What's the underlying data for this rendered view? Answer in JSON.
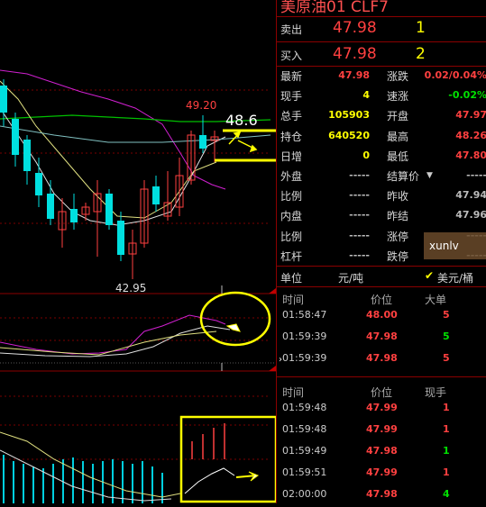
{
  "title": "美原油01  CLF7",
  "sell": {
    "label": "卖出",
    "price": "47.98",
    "qty": "1"
  },
  "buy": {
    "label": "买入",
    "price": "47.98",
    "qty": "2"
  },
  "stats_left": [
    {
      "label": "最新",
      "value": "47.98",
      "color": "red"
    },
    {
      "label": "现手",
      "value": "4",
      "color": "yellow"
    },
    {
      "label": "总手",
      "value": "105903",
      "color": "yellow"
    },
    {
      "label": "持仓",
      "value": "640520",
      "color": "yellow"
    },
    {
      "label": "日增",
      "value": "0",
      "color": "yellow"
    },
    {
      "label": "外盘",
      "value": "-----",
      "color": "gray"
    },
    {
      "label": "比例",
      "value": "-----",
      "color": "gray"
    },
    {
      "label": "内盘",
      "value": "-----",
      "color": "gray"
    },
    {
      "label": "比例",
      "value": "-----",
      "color": "gray"
    },
    {
      "label": "杠杆",
      "value": "-----",
      "color": "gray"
    }
  ],
  "stats_right": [
    {
      "label": "涨跌",
      "value": "0.02/0.04%",
      "color": "red"
    },
    {
      "label": "速涨",
      "value": "-0.02%",
      "color": "green"
    },
    {
      "label": "开盘",
      "value": "47.97",
      "color": "red"
    },
    {
      "label": "最高",
      "value": "48.26",
      "color": "red"
    },
    {
      "label": "最低",
      "value": "47.80",
      "color": "red"
    },
    {
      "label": "结算价",
      "value": "-----",
      "color": "gray"
    },
    {
      "label": "昨收",
      "value": "47.94",
      "color": "gray"
    },
    {
      "label": "昨结",
      "value": "47.96",
      "color": "gray"
    },
    {
      "label": "涨停",
      "value": "-----",
      "color": "gray"
    },
    {
      "label": "跌停",
      "value": "-----",
      "color": "gray"
    }
  ],
  "watermark": "xunlv",
  "unit_row": {
    "label": "单位",
    "unit": "元/吨",
    "currency": "美元/桶"
  },
  "trades1": {
    "headers": [
      "时间",
      "价位",
      "大单"
    ],
    "rows": [
      {
        "time": "01:58:47",
        "price": "48.00",
        "qty": "5",
        "qcolor": "red"
      },
      {
        "time": "01:59:39",
        "price": "47.98",
        "qty": "5",
        "qcolor": "green"
      },
      {
        "time": "01:59:39",
        "price": "47.98",
        "qty": "5",
        "qcolor": "red"
      }
    ]
  },
  "trades2": {
    "headers": [
      "时间",
      "价位",
      "现手"
    ],
    "rows": [
      {
        "time": "01:59:48",
        "price": "47.99",
        "qty": "1",
        "qcolor": "red"
      },
      {
        "time": "01:59:48",
        "price": "47.99",
        "qty": "1",
        "qcolor": "red"
      },
      {
        "time": "01:59:49",
        "price": "47.98",
        "qty": "1",
        "qcolor": "green"
      },
      {
        "time": "01:59:51",
        "price": "47.99",
        "qty": "1",
        "qcolor": "red"
      },
      {
        "time": "02:00:00",
        "price": "47.98",
        "qty": "4",
        "qcolor": "green"
      }
    ]
  },
  "chart": {
    "high_label": "49.20",
    "low_label": "42.95",
    "annot_price": "48.6"
  }
}
